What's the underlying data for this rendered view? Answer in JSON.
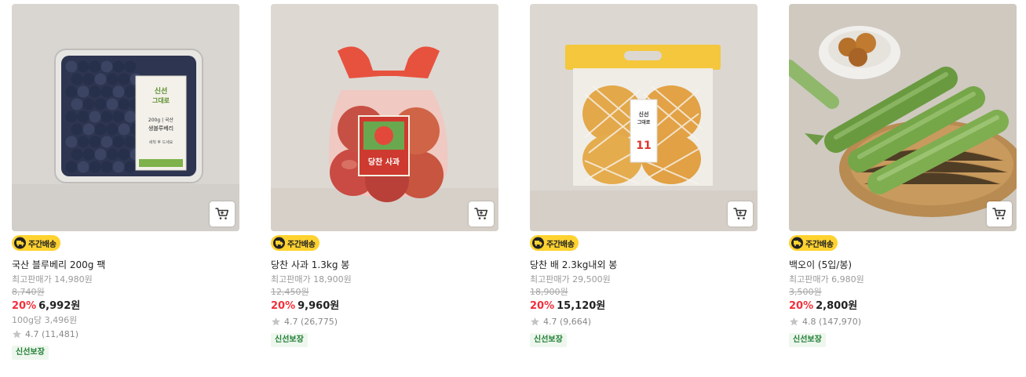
{
  "products": [
    {
      "badge": "주간배송",
      "name": "국산 블루베리 200g 팩",
      "original_price": "최고판매가 14,980원",
      "strike_price": "8,740원",
      "discount": "20%",
      "price": "6,992원",
      "unit_price": "100g당 3,496원",
      "rating": "4.7 (11,481)",
      "fresh_tag": "신선보장",
      "package_text": [
        "신선",
        "그대로",
        "200g | 국산",
        "생블루베리",
        "세척 후 드세요"
      ]
    },
    {
      "badge": "주간배송",
      "name": "당찬 사과 1.3kg 봉",
      "original_price": "최고판매가 18,900원",
      "strike_price": "12,450원",
      "discount": "20%",
      "price": "9,960원",
      "rating": "4.7 (26,775)",
      "fresh_tag": "신선보장",
      "package_text": [
        "당찬 사과"
      ]
    },
    {
      "badge": "주간배송",
      "name": "당찬 배 2.3kg내외 봉",
      "original_price": "최고판매가 29,500원",
      "strike_price": "18,900원",
      "discount": "20%",
      "price": "15,120원",
      "rating": "4.7 (9,664)",
      "fresh_tag": "신선보장",
      "package_text": [
        "신선",
        "그대로",
        "11"
      ]
    },
    {
      "badge": "주간배송",
      "name": "백오이 (5입/봉)",
      "original_price": "최고판매가 6,980원",
      "strike_price": "3,500원",
      "discount": "20%",
      "price": "2,800원",
      "rating": "4.8 (147,970)",
      "fresh_tag": "신선보장"
    }
  ],
  "colors": {
    "discount": "#f2303b",
    "badge_bg": "#ffd230",
    "fresh_text": "#1f7d33",
    "fresh_bg": "#eef7ee"
  },
  "icons": {
    "cart": "cart-icon",
    "badge": "delivery-truck-icon",
    "rating": "star-icon"
  }
}
